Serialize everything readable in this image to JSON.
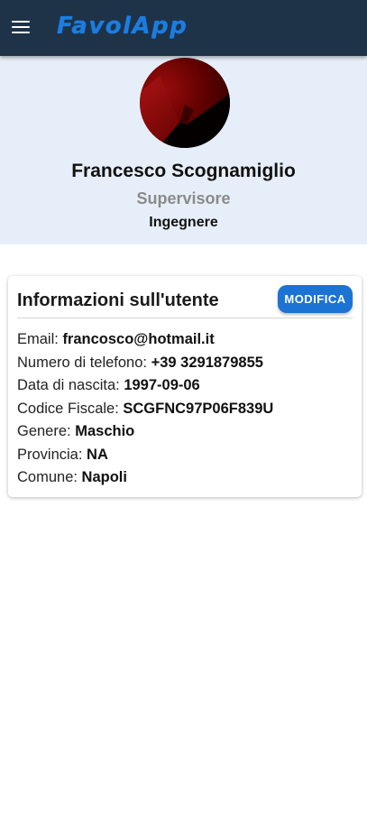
{
  "app": {
    "logo_text": "FavolApp",
    "appbar_color": "#1e3248",
    "accent_color": "#1b73d3"
  },
  "profile": {
    "name": "Francesco Scognamiglio",
    "role": "Supervisore",
    "profession": "Ingegnere",
    "header_background": "#e6eff9"
  },
  "info_card": {
    "title": "Informazioni sull'utente",
    "edit_label": "MODIFICA",
    "fields": [
      {
        "label": "Email:",
        "value": "francosco@hotmail.it"
      },
      {
        "label": "Numero di telefono:",
        "value": "+39 3291879855"
      },
      {
        "label": "Data di nascita:",
        "value": "1997-09-06"
      },
      {
        "label": "Codice Fiscale:",
        "value": "SCGFNC97P06F839U"
      },
      {
        "label": "Genere:",
        "value": "Maschio"
      },
      {
        "label": "Provincia:",
        "value": "NA"
      },
      {
        "label": "Comune:",
        "value": "Napoli"
      }
    ]
  },
  "icons": {
    "menu": "hamburger-menu-icon",
    "avatar": "profile-avatar-image"
  }
}
